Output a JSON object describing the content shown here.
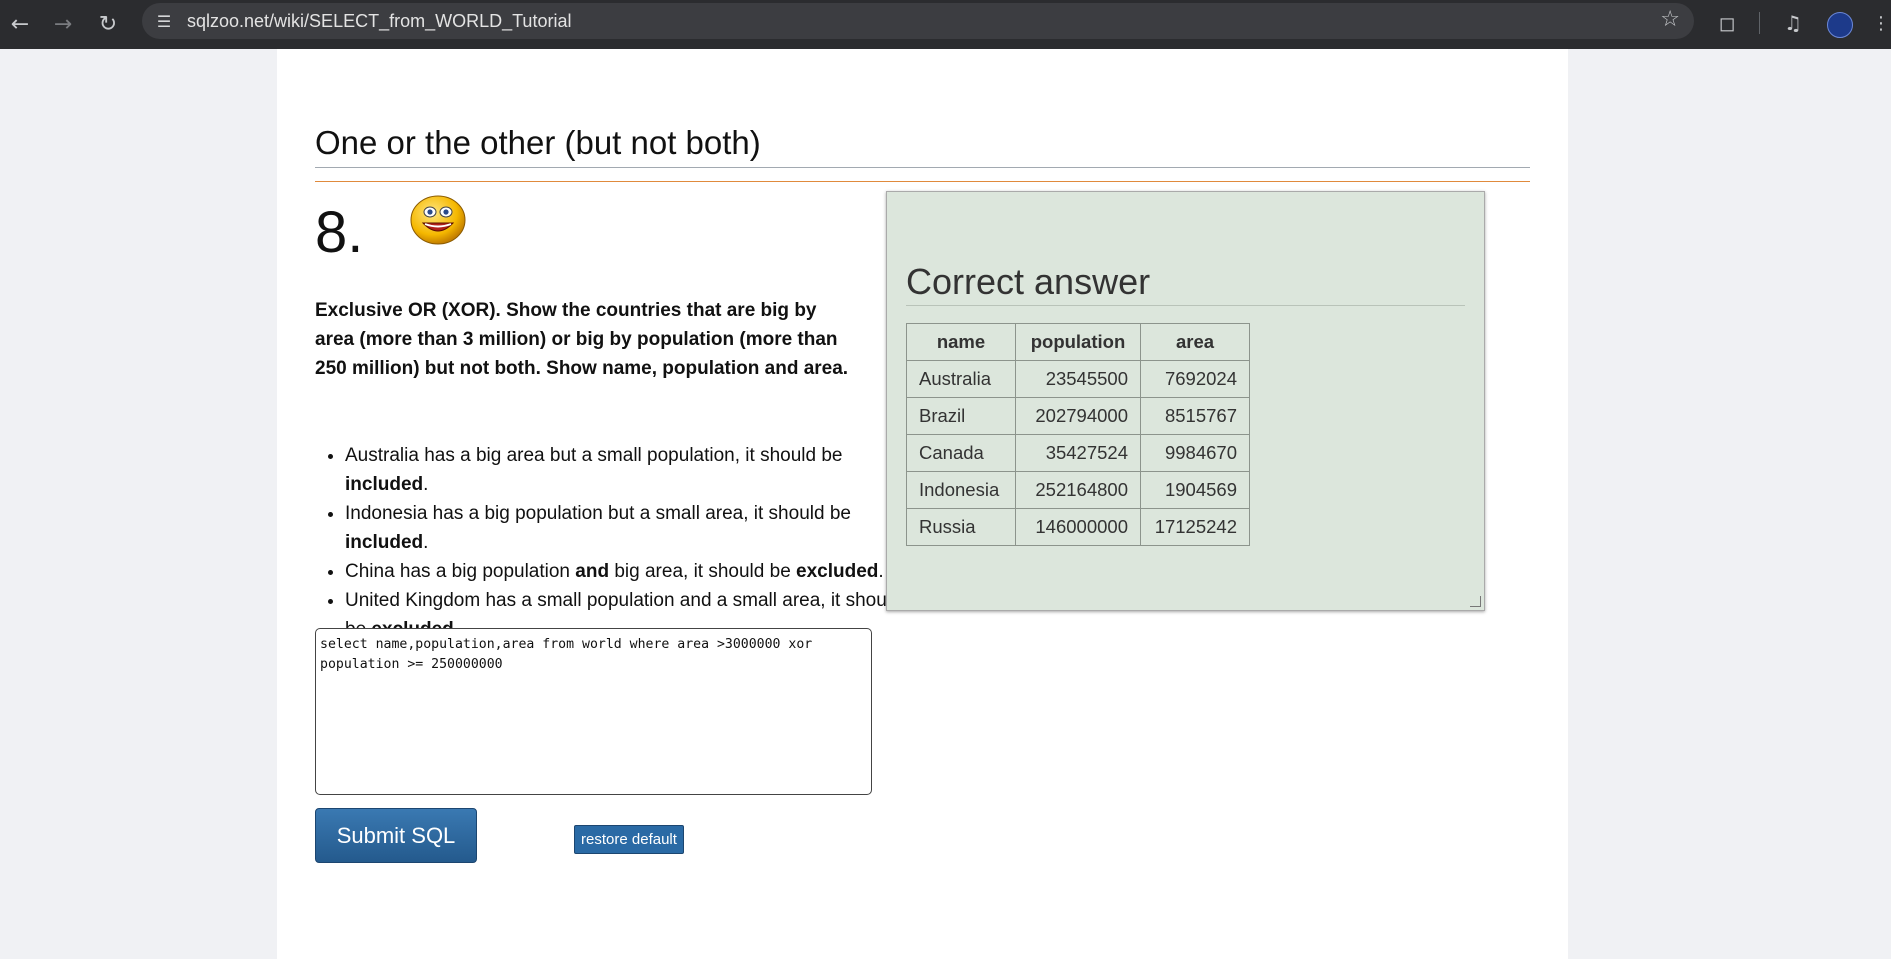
{
  "browser": {
    "url": "sqlzoo.net/wiki/SELECT_from_WORLD_Tutorial",
    "icons": [
      "back-icon",
      "forward-icon",
      "reload-icon",
      "site-info-icon",
      "bookmark-star-icon",
      "extensions-icon",
      "media-icon",
      "profile-avatar"
    ]
  },
  "section": {
    "heading": "One or the other (but not both)",
    "number": "8."
  },
  "question": {
    "description": "Exclusive OR (XOR). Show the countries that are big by area (more than 3 million) or big by population (more than 250 million) but not both. Show name, population and area.",
    "bullets": [
      {
        "pre": "Australia has a big area but a small population, it should be ",
        "bold": "included",
        "post": "."
      },
      {
        "pre": "Indonesia has a big population but a small area, it should be ",
        "bold": "included",
        "post": "."
      },
      {
        "pre": "China has a big population ",
        "bold": "and",
        "post": " big area, it should be ",
        "bold2": "excluded",
        "post2": "."
      },
      {
        "pre": "United Kingdom has a small population and a small area, it should be ",
        "bold": "excluded",
        "post": "."
      }
    ]
  },
  "editor": {
    "sql": "select name,population,area from world where area >3000000 xor\npopulation >= 250000000"
  },
  "buttons": {
    "submit": "Submit SQL",
    "restore": "restore default"
  },
  "answer": {
    "title": "Correct answer",
    "columns": [
      "name",
      "population",
      "area"
    ],
    "rows": [
      [
        "Australia",
        "23545500",
        "7692024"
      ],
      [
        "Brazil",
        "202794000",
        "8515767"
      ],
      [
        "Canada",
        "35427524",
        "9984670"
      ],
      [
        "Indonesia",
        "252164800",
        "1904569"
      ],
      [
        "Russia",
        "146000000",
        "17125242"
      ]
    ]
  },
  "colors": {
    "answer_bg": "#dce6dc",
    "button_blue": "#2a6aa5",
    "rule_orange": "#e08a3c"
  }
}
